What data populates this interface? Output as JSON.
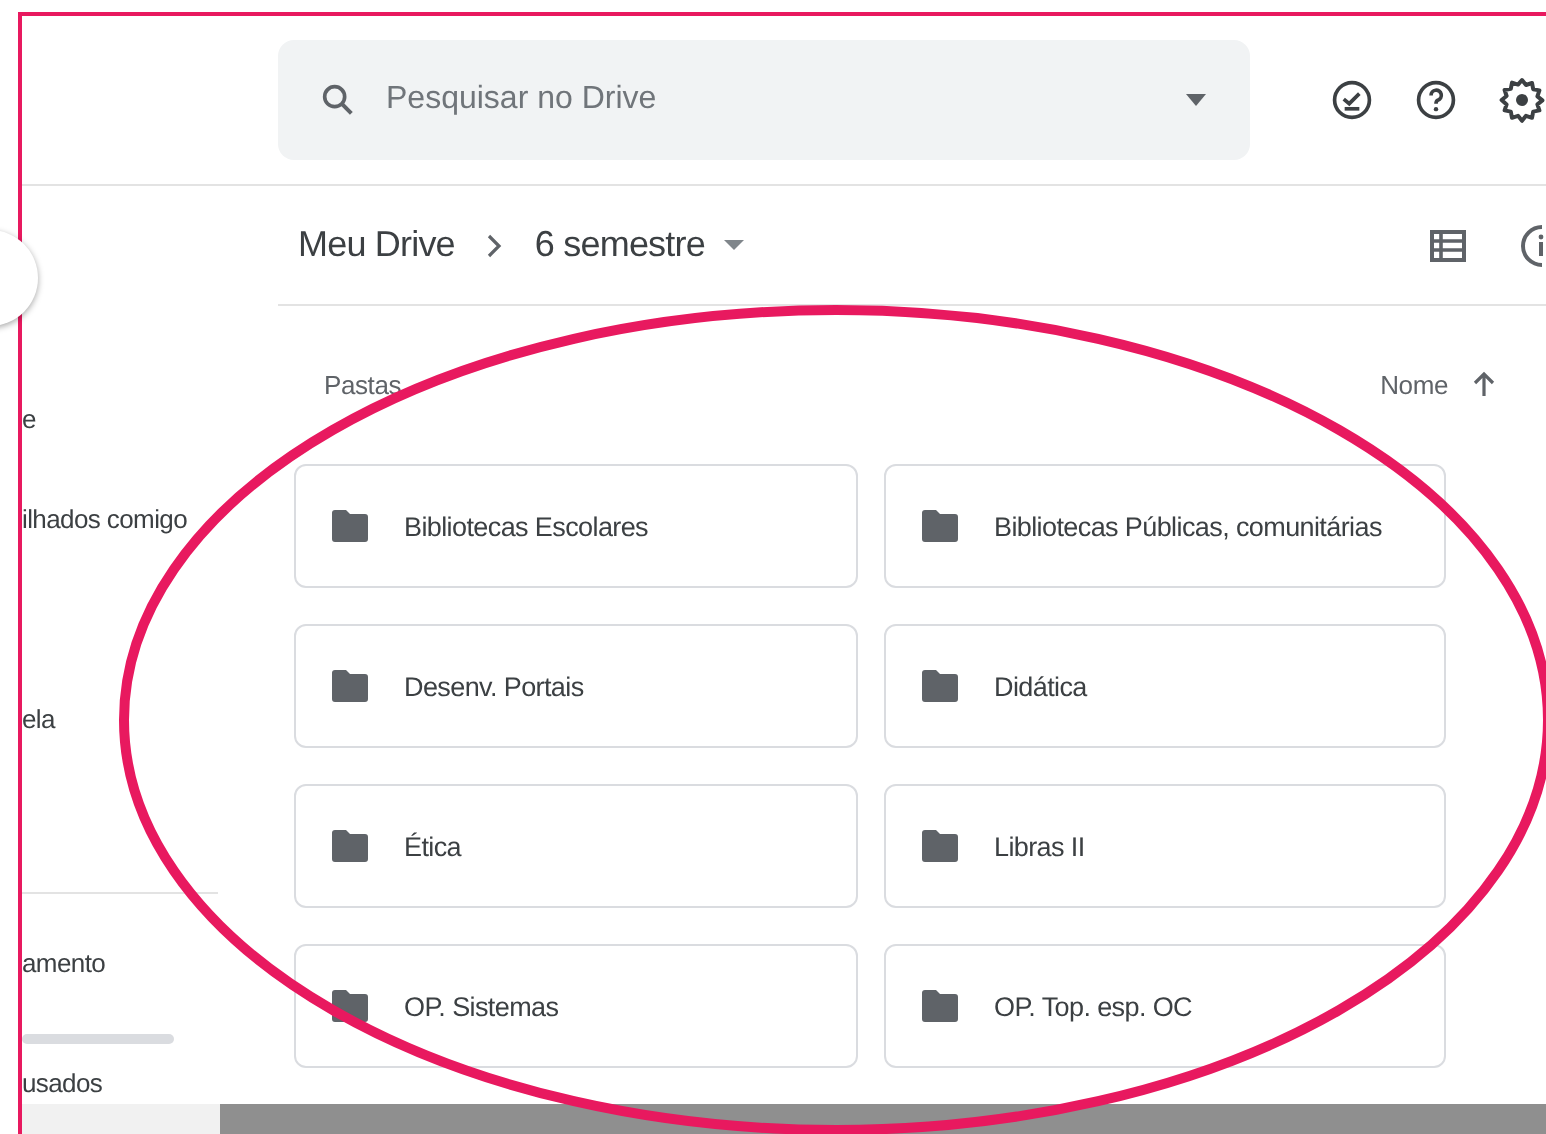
{
  "search": {
    "placeholder": "Pesquisar no Drive"
  },
  "breadcrumb": {
    "parent": "Meu Drive",
    "current": "6 semestre"
  },
  "sidebar": {
    "items": [
      "e",
      "ilhados comigo",
      "ela"
    ],
    "storage_label": "amento",
    "storage_usage": "usados"
  },
  "content": {
    "folders_heading": "Pastas",
    "sort_label": "Nome"
  },
  "folders": [
    {
      "name": "Bibliotecas Escolares"
    },
    {
      "name": "Bibliotecas Públicas, comunitárias"
    },
    {
      "name": "Desenv. Portais"
    },
    {
      "name": "Didática"
    },
    {
      "name": "Ética"
    },
    {
      "name": "Libras II"
    },
    {
      "name": "OP. Sistemas"
    },
    {
      "name": "OP. Top. esp. OC"
    }
  ]
}
